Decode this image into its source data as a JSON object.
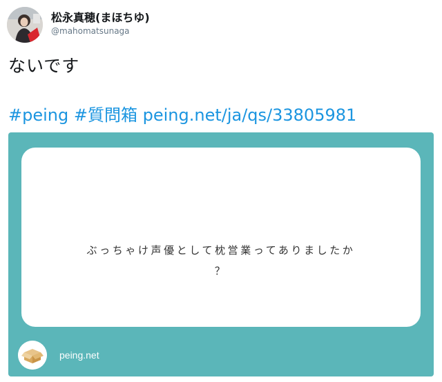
{
  "author": {
    "display_name": "松永真穂(まほちゆ)",
    "handle": "@mahomatsunaga",
    "avatar_icon": "avatar-photo"
  },
  "tweet": {
    "text": "ないです",
    "hashtags": [
      "#peing",
      "#質問箱"
    ],
    "url": "peing.net/ja/qs/33805981"
  },
  "card": {
    "question_line1": "ぶっちゃけ声優として枕営業ってありましたか",
    "question_line2": "？",
    "domain": "peing.net",
    "logo_icon": "peing-box-icon",
    "background_color": "#5bb6b9"
  },
  "colors": {
    "link": "#1b95e0",
    "text": "#14171a",
    "muted": "#657786"
  }
}
